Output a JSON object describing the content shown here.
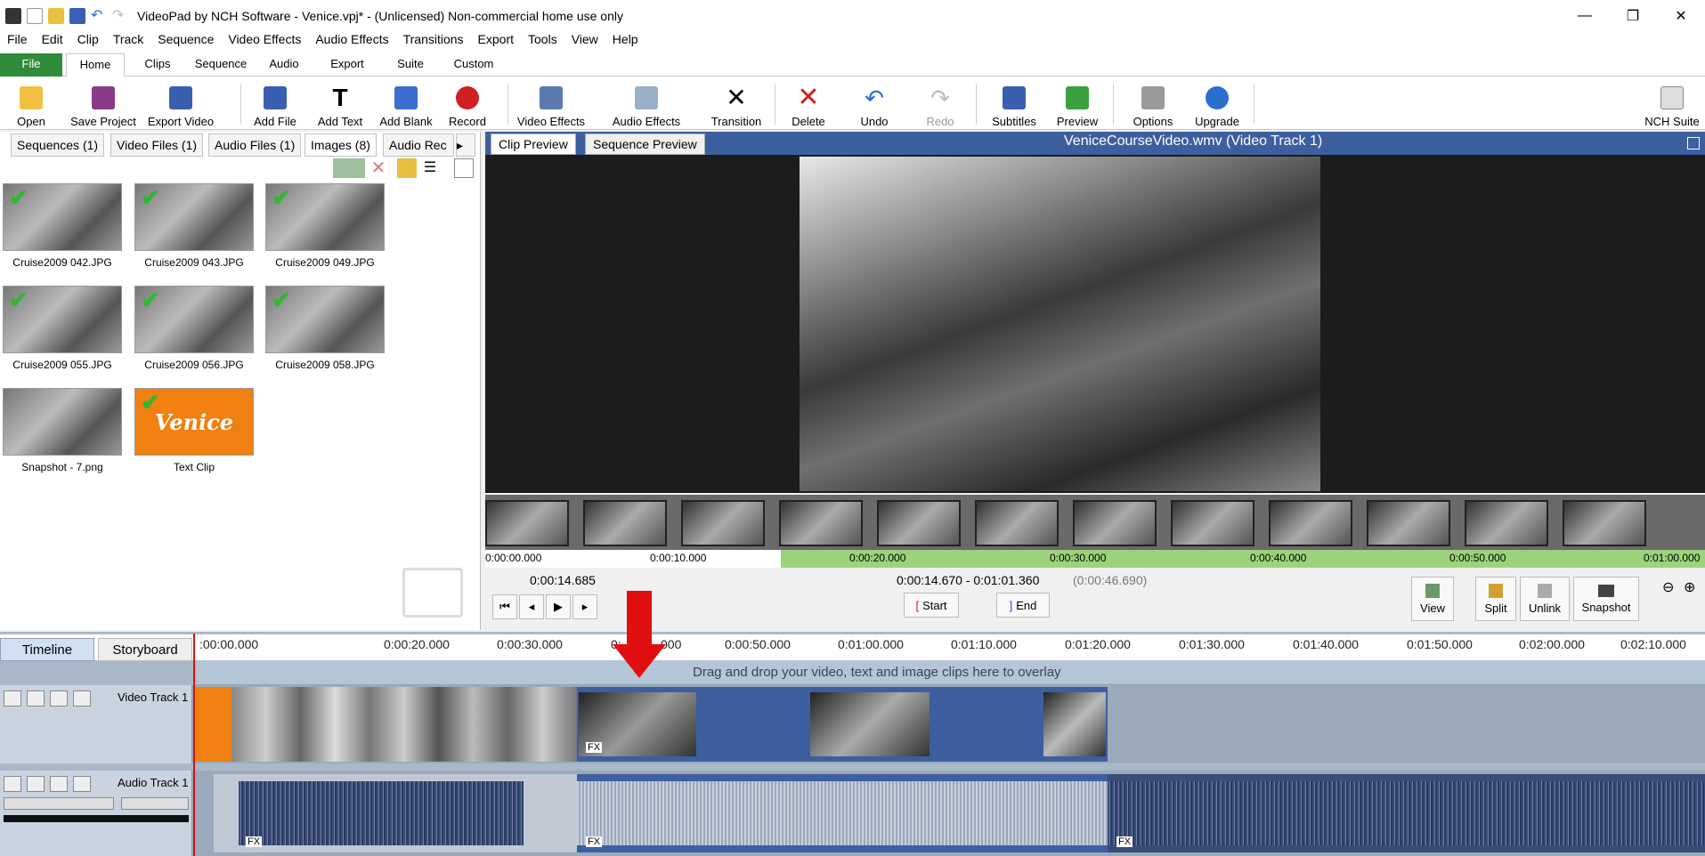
{
  "window": {
    "title": "VideoPad by NCH Software - Venice.vpj* - (Unlicensed) Non-commercial home use only"
  },
  "menu": [
    "File",
    "Edit",
    "Clip",
    "Track",
    "Sequence",
    "Video Effects",
    "Audio Effects",
    "Transitions",
    "Export",
    "Tools",
    "View",
    "Help"
  ],
  "ribbon_tabs": [
    "File",
    "Home",
    "Clips",
    "Sequence",
    "Audio",
    "Export",
    "Suite",
    "Custom"
  ],
  "toolbar": [
    "Open",
    "Save Project",
    "Export Video",
    "Add File",
    "Add Text",
    "Add Blank",
    "Record",
    "Video Effects",
    "Audio Effects",
    "Transition",
    "Delete",
    "Undo",
    "Redo",
    "Subtitles",
    "Preview",
    "Options",
    "Upgrade",
    "NCH Suite"
  ],
  "bin_tabs": [
    "Sequences (1)",
    "Video Files (1)",
    "Audio Files (1)",
    "Images (8)",
    "Audio Rec"
  ],
  "bin_items": [
    "Cruise2009 042.JPG",
    "Cruise2009 043.JPG",
    "Cruise2009 049.JPG",
    "Cruise2009 055.JPG",
    "Cruise2009 056.JPG",
    "Cruise2009 058.JPG",
    "Snapshot - 7.png",
    "Text Clip"
  ],
  "text_clip_label": "Venice",
  "preview": {
    "tabs": [
      "Clip Preview",
      "Sequence Preview"
    ],
    "title": "VeniceCourseVideo.wmv (Video Track 1)",
    "ruler": [
      "0:00:00.000",
      "0:00:10.000",
      "0:00:20.000",
      "0:00:30.000",
      "0:00:40.000",
      "0:00:50.000",
      "0:01:00.000"
    ],
    "current_time": "0:00:14.685",
    "range": "0:00:14.670 - 0:01:01.360",
    "duration": "(0:00:46.690)",
    "start": "Start",
    "end": "End",
    "tools": [
      "View",
      "Split",
      "Unlink",
      "Snapshot"
    ]
  },
  "timeline": {
    "tabs": [
      "Timeline",
      "Storyboard"
    ],
    "ticks": [
      ":00:00.000",
      "0:00:20.000",
      "0:00:30.000",
      "0:",
      "000",
      "0:00:50.000",
      "0:01:00.000",
      "0:01:10.000",
      "0:01:20.000",
      "0:01:30.000",
      "0:01:40.000",
      "0:01:50.000",
      "0:02:00.000",
      "0:02:10.000"
    ],
    "overlay_hint": "Drag and drop your video, text and image clips here to overlay",
    "video_track": "Video Track 1",
    "audio_track": "Audio Track 1",
    "fx": "FX"
  },
  "colors": {
    "accent": "#3d5fa0",
    "file_tab": "#2e8b3a",
    "arrow": "#e01010",
    "text_clip": "#f08010"
  }
}
